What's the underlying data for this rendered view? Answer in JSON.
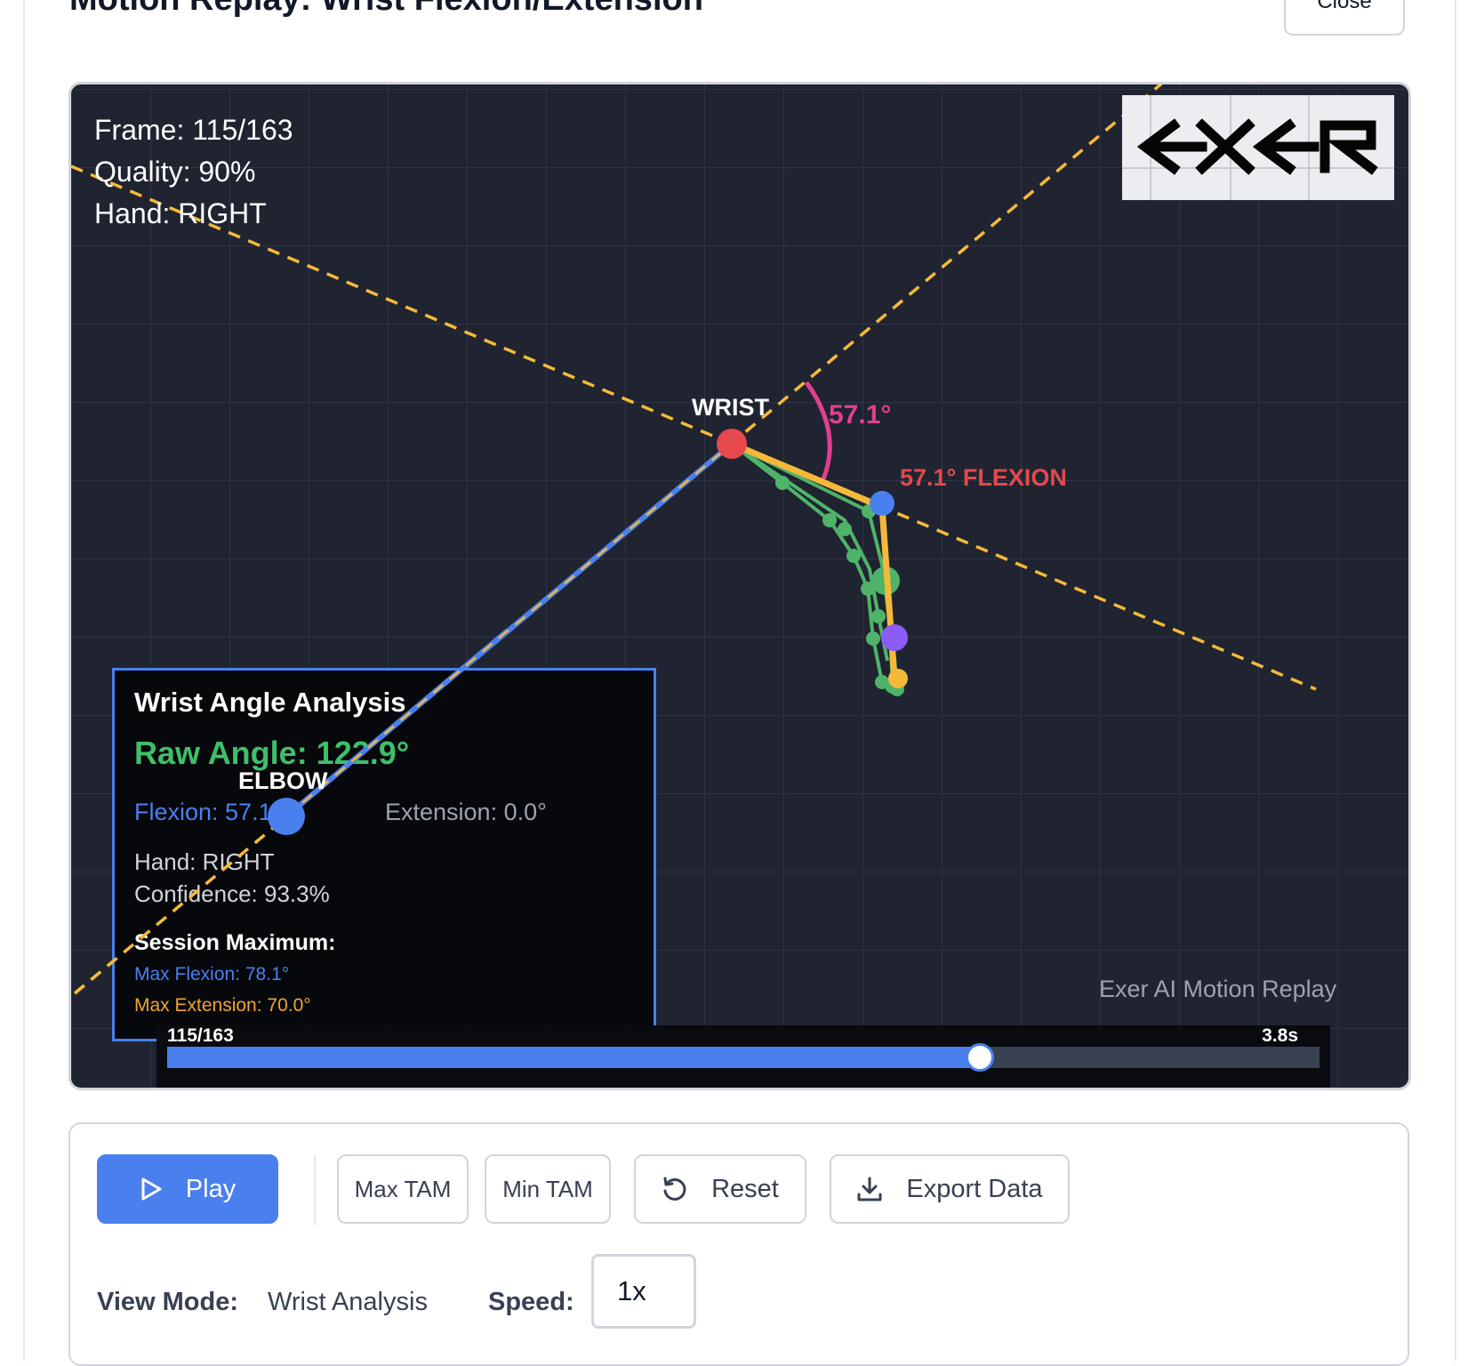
{
  "dialog": {
    "title": "Motion Replay: Wrist Flexion/Extension",
    "close_label": "Close"
  },
  "viewer": {
    "hud": {
      "frame": "Frame: 115/163",
      "quality": "Quality: 90%",
      "hand": "Hand: RIGHT"
    },
    "logo_text": "EXER",
    "labels": {
      "wrist": "WRIST",
      "elbow": "ELBOW",
      "arc_angle": "57.1°",
      "flexion_tag": "57.1° FLEXION"
    },
    "analysis_panel": {
      "title": "Wrist Angle Analysis",
      "raw_angle": "Raw Angle: 122.9°",
      "flexion": "Flexion: 57.1°",
      "extension": "Extension: 0.0°",
      "hand": "Hand: RIGHT",
      "confidence": "Confidence: 93.3%",
      "session_title": "Session Maximum:",
      "max_flexion": "Max Flexion: 78.1°",
      "max_extension": "Max Extension: 70.0°"
    },
    "watermark": "Exer AI Motion Replay",
    "scrubber": {
      "frame_label": "115/163",
      "time_label": "3.8s",
      "current_frame": 115,
      "total_frames": 163
    },
    "colors": {
      "background": "#1f2430",
      "grid": "#2d3444",
      "forearm": "#4a80ee",
      "guide": "#f5b93a",
      "wrist_joint": "#e5484d",
      "arc": "#e0408f",
      "fingers": "#4fb36a",
      "flexion_tag": "#e5484d"
    }
  },
  "controls": {
    "play_label": "Play",
    "max_tam_label": "Max TAM",
    "min_tam_label": "Min TAM",
    "reset_label": "Reset",
    "export_label": "Export Data",
    "view_mode_label": "View Mode:",
    "view_mode_value": "Wrist Analysis",
    "speed_label": "Speed:",
    "speed_value": "1x",
    "primary_color": "#4a80ee"
  }
}
